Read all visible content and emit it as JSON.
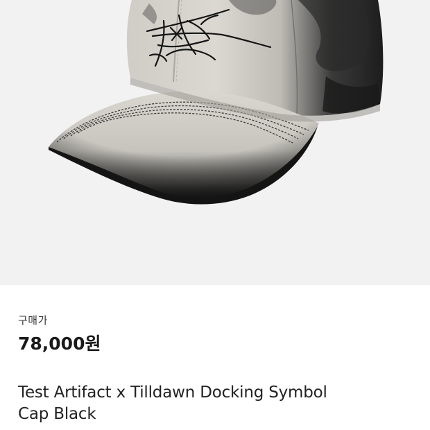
{
  "product": {
    "image_alt": "hat-image",
    "price_label": "구매가",
    "price": "78,000원",
    "title_line1": "Test Artifact x Tilldawn Docking Symbol",
    "title_line2": "Cap Black"
  },
  "colors": {
    "image_background": "#f2f2f2",
    "cap_light": "#d8d6cf",
    "cap_dark": "#1c1c1c",
    "text_primary": "#1a1a1a"
  }
}
